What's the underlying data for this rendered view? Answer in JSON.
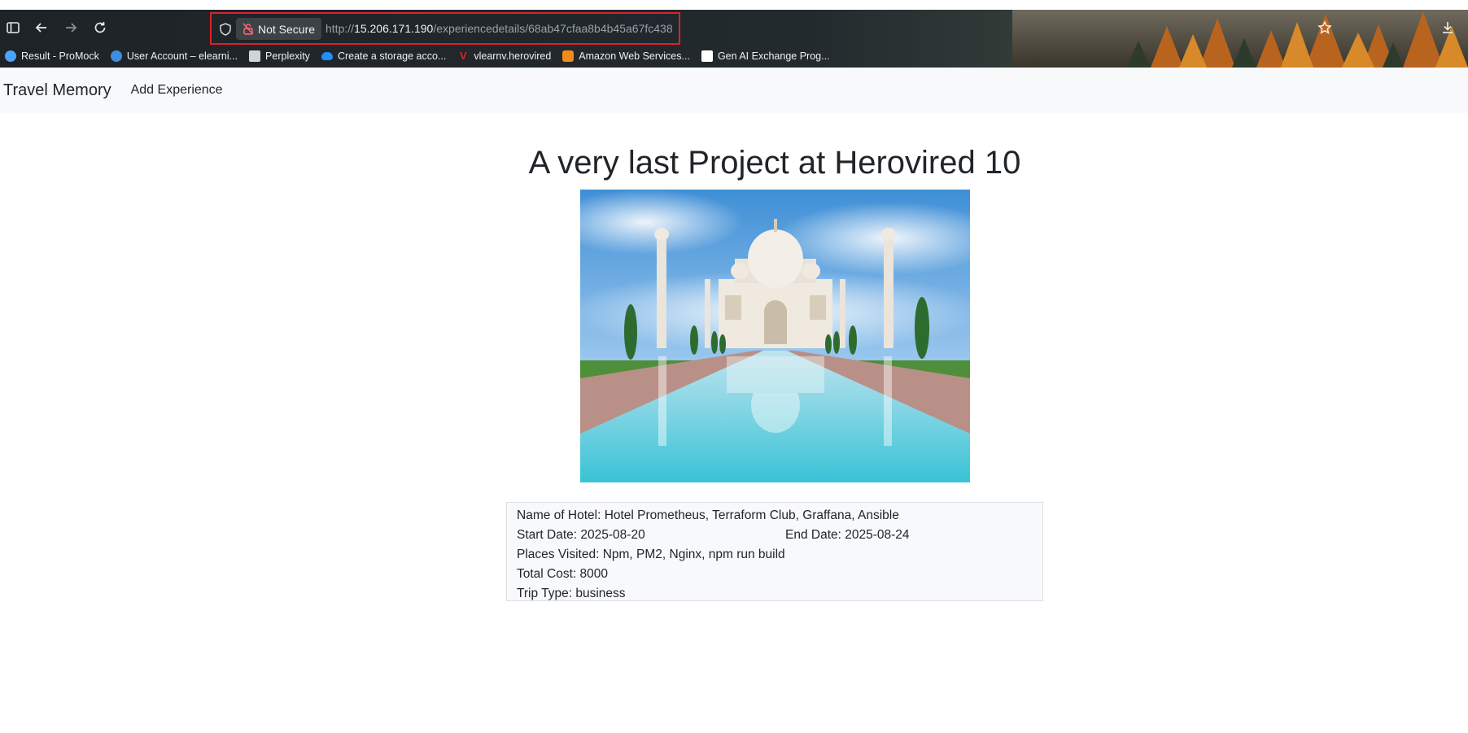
{
  "browser": {
    "security_label": "Not Secure",
    "url_scheme": "http://",
    "url_host": "15.206.171.190",
    "url_path": "/experiencedetails/68ab47cfaa8b4b45a67fc438",
    "bookmarks": [
      {
        "label": "Result - ProMock",
        "icon": "promock-icon",
        "color": "#4aa3ff"
      },
      {
        "label": "User Account – elearni...",
        "icon": "elearning-icon",
        "color": "#3b8fe0"
      },
      {
        "label": "Perplexity",
        "icon": "perplexity-icon",
        "color": "#cfd4d8"
      },
      {
        "label": "Create a storage acco...",
        "icon": "azure-cloud-icon",
        "color": "#1e90ff"
      },
      {
        "label": "vlearnv.herovired",
        "icon": "herovired-icon",
        "color": "#e0202a"
      },
      {
        "label": "Amazon Web Services...",
        "icon": "aws-icon",
        "color": "#f08a1c"
      },
      {
        "label": "Gen AI Exchange Prog...",
        "icon": "genai-icon",
        "color": "#ffffff"
      }
    ]
  },
  "nav": {
    "brand": "Travel Memory",
    "add_experience": "Add Experience"
  },
  "experience": {
    "title": "A very last Project at Herovired 10",
    "hotel_label": "Name of Hotel: ",
    "hotel": "Hotel Prometheus, Terraform Club, Graffana, Ansible",
    "start_label": "Start Date: ",
    "start": "2025-08-20",
    "end_label": "End Date: ",
    "end": "2025-08-24",
    "places_label": "Places Visited: ",
    "places": "Npm, PM2, Nginx, npm run build",
    "cost_label": "Total Cost: ",
    "cost": "8000",
    "trip_label": "Trip Type: ",
    "trip": "business"
  }
}
